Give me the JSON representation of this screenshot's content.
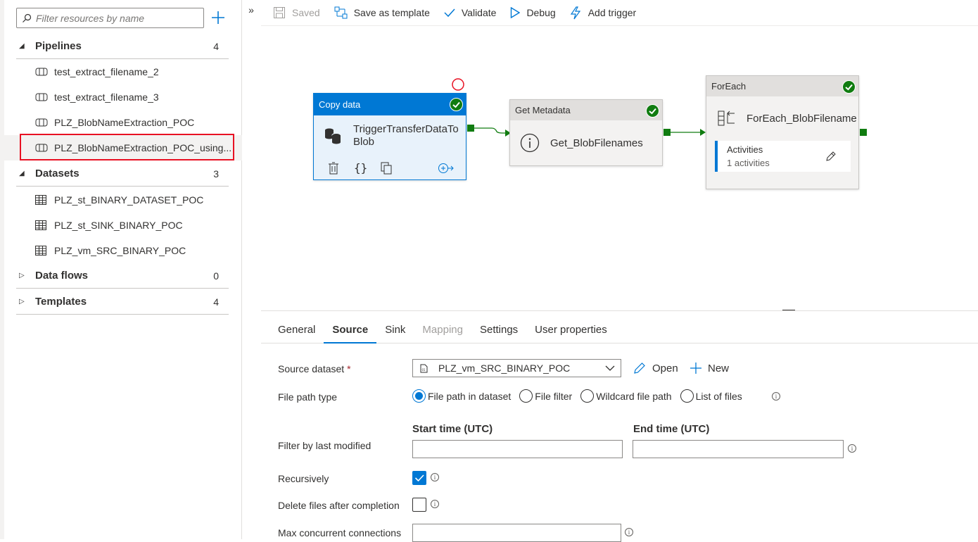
{
  "search": {
    "placeholder": "Filter resources by name"
  },
  "sections": {
    "pipelines": {
      "label": "Pipelines",
      "count": "4"
    },
    "datasets": {
      "label": "Datasets",
      "count": "3"
    },
    "dataflows": {
      "label": "Data flows",
      "count": "0"
    },
    "templates": {
      "label": "Templates",
      "count": "4"
    }
  },
  "pipelines": [
    "test_extract_filename_2",
    "test_extract_filename_3",
    "PLZ_BlobNameExtraction_POC",
    "PLZ_BlobNameExtraction_POC_using..."
  ],
  "datasets": [
    "PLZ_st_BINARY_DATASET_POC",
    "PLZ_st_SINK_BINARY_POC",
    "PLZ_vm_SRC_BINARY_POC"
  ],
  "toolbar": {
    "saved": "Saved",
    "save_template": "Save as template",
    "validate": "Validate",
    "debug": "Debug",
    "add_trigger": "Add trigger"
  },
  "canvas": {
    "copy": {
      "type": "Copy data",
      "name_line1": "TriggerTransferDataTo",
      "name_line2": "Blob"
    },
    "meta": {
      "type": "Get Metadata",
      "name": "Get_BlobFilenames"
    },
    "foreach": {
      "type": "ForEach",
      "name": "ForEach_BlobFilename",
      "activities_label": "Activities",
      "activities_count": "1 activities"
    }
  },
  "tabs": [
    "General",
    "Source",
    "Sink",
    "Mapping",
    "Settings",
    "User properties"
  ],
  "source": {
    "dataset_label": "Source dataset",
    "required_mark": "*",
    "dataset_value": "PLZ_vm_SRC_BINARY_POC",
    "open": "Open",
    "new": "New",
    "file_path_type_label": "File path type",
    "file_path_options": [
      "File path in dataset",
      "File filter",
      "Wildcard file path",
      "List of files"
    ],
    "start_time_label": "Start time (UTC)",
    "end_time_label": "End time (UTC)",
    "filter_label": "Filter by last modified",
    "recursively_label": "Recursively",
    "delete_label": "Delete files after completion",
    "max_conn_label": "Max concurrent connections"
  },
  "colors": {
    "accent": "#0078d4",
    "success": "#107c10",
    "highlight": "#e81123"
  }
}
